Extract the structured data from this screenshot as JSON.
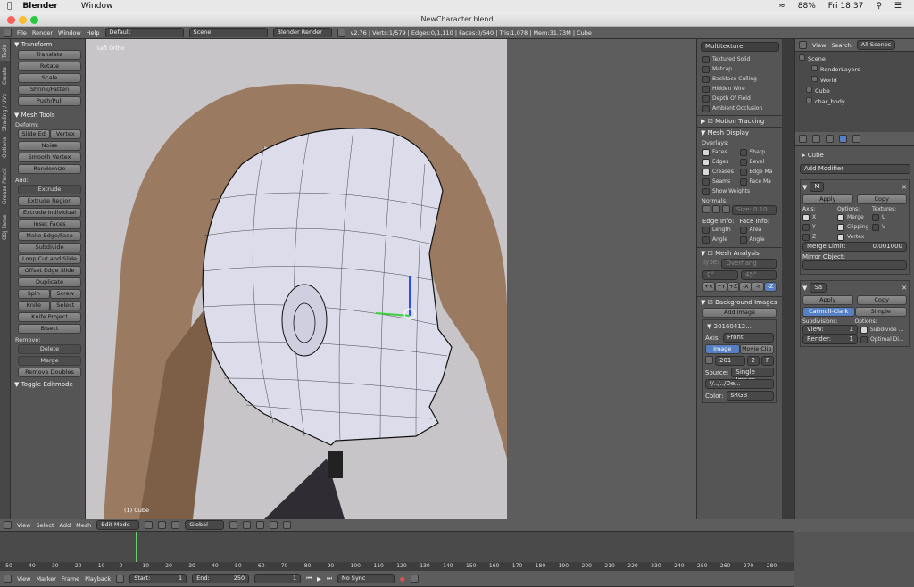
{
  "mac": {
    "app": "Blender",
    "menu_window": "Window",
    "battery": "88%",
    "time": "Fri 18:37"
  },
  "window": {
    "title": "NewCharacter.blend"
  },
  "info": {
    "menus": [
      "File",
      "Render",
      "Window",
      "Help"
    ],
    "layout": "Default",
    "scene": "Scene",
    "engine": "Blender Render",
    "stats": "v2.76 | Verts:1/579 | Edges:0/1,110 | Faces:0/540 | Tris:1,078 | Mem:31.73M | Cube"
  },
  "tools": {
    "tabs": [
      "Tools",
      "Create",
      "Shading / UVs",
      "Options",
      "Grease Pencil",
      "OBJ Fame"
    ],
    "transform_header": "Transform",
    "transform": [
      "Translate",
      "Rotate",
      "Scale",
      "Shrink/Fatten",
      "Push/Pull"
    ],
    "mesh_header": "Mesh Tools",
    "deform_label": "Deform:",
    "slide_edge": "Slide Ed",
    "vertex": "Vertex",
    "deform": [
      "Noise",
      "Smooth Vertex",
      "Randomize"
    ],
    "add_label": "Add:",
    "add": [
      "Extrude",
      "Extrude Region",
      "Extrude Individual",
      "Inset Faces",
      "Make Edge/Face",
      "Subdivide",
      "Loop Cut and Slide",
      "Offset Edge Slide",
      "Duplicate"
    ],
    "spin": "Spin",
    "screw": "Screw",
    "knife": "Knife",
    "select": "Select",
    "knife_project": "Knife Project",
    "bisect": "Bisect",
    "remove_label": "Remove:",
    "delete": "Delete",
    "merge": "Merge",
    "remove_doubles": "Remove Doubles",
    "toggle_editmode": "Toggle Editmode"
  },
  "viewport": {
    "view_label": "Left Ortho",
    "object_label": "(1) Cube"
  },
  "props": {
    "shading": "Multitexture",
    "shade_checks": [
      {
        "label": "Textured Solid",
        "on": false
      },
      {
        "label": "Matcap",
        "on": false
      },
      {
        "label": "Backface Culling",
        "on": false
      },
      {
        "label": "Hidden Wire",
        "on": false
      },
      {
        "label": "Depth Of Field",
        "on": false
      },
      {
        "label": "Ambient Occlusion",
        "on": false
      }
    ],
    "motion_tracking": "Motion Tracking",
    "mesh_display": "Mesh Display",
    "overlays": "Overlays:",
    "ov_left": [
      {
        "label": "Faces",
        "on": true
      },
      {
        "label": "Edges",
        "on": true
      },
      {
        "label": "Creases",
        "on": true
      },
      {
        "label": "Seams",
        "on": false
      }
    ],
    "ov_right": [
      {
        "label": "Sharp",
        "on": false
      },
      {
        "label": "Bevel",
        "on": false
      },
      {
        "label": "Edge Ma",
        "on": false
      },
      {
        "label": "Face Ma",
        "on": false
      }
    ],
    "show_weights": "Show Weights",
    "normals": "Normals:",
    "size": "Size: 0.10",
    "edge_info": "Edge Info:",
    "face_info": "Face Info:",
    "length": "Length",
    "area": "Area",
    "angle1": "Angle",
    "angle2": "Angle",
    "mesh_analysis": "Mesh Analysis",
    "type": "Type:",
    "overhang": "Overhang",
    "deg0": "0°",
    "deg45": "45°",
    "axes": [
      "+X",
      "+Y",
      "+Z",
      "-X",
      "-Y",
      "-Z"
    ],
    "bg_images": "Background Images",
    "add_image": "Add Image",
    "img_name": "20160412...",
    "axis": "Axis:",
    "front": "Front",
    "image_tab": "Image",
    "movie_tab": "Movie Clip",
    "img_field": "201",
    "img_num": "2",
    "img_f": "F",
    "source": "Source:",
    "single_image": "Single Image",
    "path": "//../../De...",
    "color": "Color:",
    "srgb": "sRGB"
  },
  "outliner": {
    "tabs": [
      "View",
      "Search",
      "All Scenes"
    ],
    "items": [
      "Scene",
      "RenderLayers",
      "World",
      "Cube",
      "char_body"
    ]
  },
  "modifiers": {
    "object": "Cube",
    "add_modifier": "Add Modifier",
    "mirror_name": "M",
    "apply": "Apply",
    "copy": "Copy",
    "axis": "Axis:",
    "options": "Options:",
    "textures": "Textures:",
    "axes": [
      {
        "label": "X",
        "on": true
      },
      {
        "label": "Y",
        "on": false
      },
      {
        "label": "Z",
        "on": false
      }
    ],
    "opts": [
      {
        "label": "Merge",
        "on": true
      },
      {
        "label": "Clipping",
        "on": true
      },
      {
        "label": "Vertex",
        "on": true
      }
    ],
    "tex": [
      {
        "label": "U",
        "on": false
      },
      {
        "label": "V",
        "on": false
      }
    ],
    "merge_limit_label": "Merge Limit:",
    "merge_limit": "0.001000",
    "mirror_object": "Mirror Object:",
    "subsurf_name": "Sa",
    "catmull": "Catmull-Clark",
    "simple": "Simple",
    "subdivisions": "Subdivisions:",
    "view_label": "View:",
    "view_val": "1",
    "render_label": "Render:",
    "render_val": "1",
    "subdiv_uv": "Subdivide ...",
    "optimal": "Optimal Di..."
  },
  "v3d_header": {
    "menus": [
      "View",
      "Select",
      "Add",
      "Mesh"
    ],
    "mode": "Edit Mode",
    "orient": "Global"
  },
  "timeline": {
    "ticks": [
      "-50",
      "-40",
      "-30",
      "-20",
      "-10",
      "0",
      "10",
      "20",
      "30",
      "40",
      "50",
      "60",
      "70",
      "80",
      "90",
      "100",
      "110",
      "120",
      "130",
      "140",
      "150",
      "160",
      "170",
      "180",
      "190",
      "200",
      "210",
      "220",
      "230",
      "240",
      "250",
      "260",
      "270",
      "280"
    ],
    "menus": [
      "View",
      "Marker",
      "Frame",
      "Playback"
    ],
    "start_label": "Start:",
    "start": "1",
    "end_label": "End:",
    "end": "250",
    "current": "1",
    "sync": "No Sync"
  }
}
